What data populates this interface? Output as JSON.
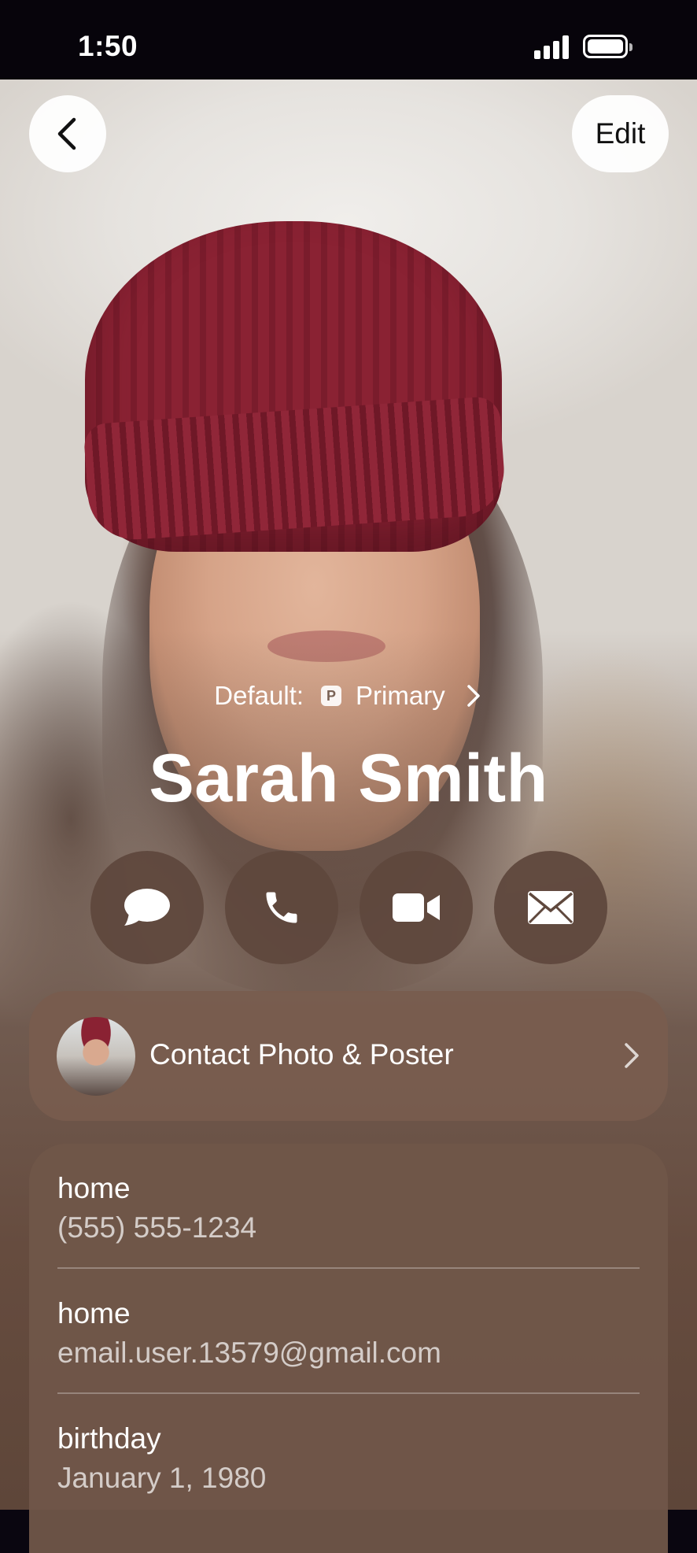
{
  "status_bar": {
    "time": "1:50"
  },
  "header": {
    "edit_label": "Edit"
  },
  "contact": {
    "default_label": "Default:",
    "default_badge": "P",
    "default_value": "Primary",
    "name": "Sarah Smith"
  },
  "actions": [
    {
      "name": "message",
      "icon": "message-bubble-icon"
    },
    {
      "name": "call",
      "icon": "phone-icon"
    },
    {
      "name": "video",
      "icon": "video-camera-icon"
    },
    {
      "name": "mail",
      "icon": "envelope-icon"
    }
  ],
  "photo_poster": {
    "label": "Contact Photo & Poster"
  },
  "details": [
    {
      "label": "home",
      "value": "(555) 555-1234"
    },
    {
      "label": "home",
      "value": "email.user.13579@gmail.com"
    },
    {
      "label": "birthday",
      "value": "January 1, 1980"
    }
  ]
}
